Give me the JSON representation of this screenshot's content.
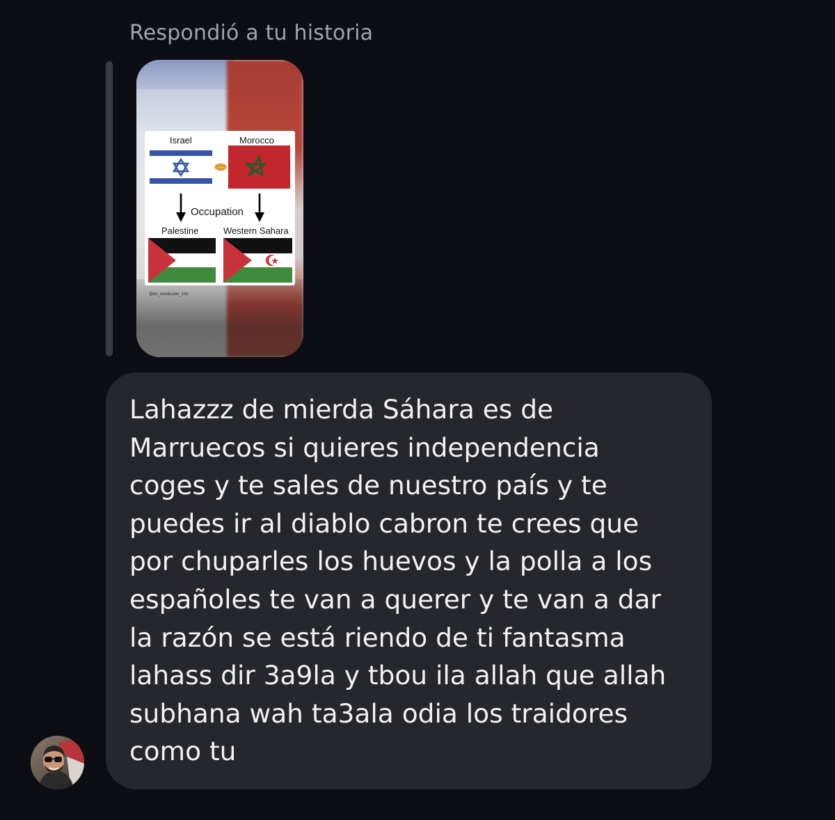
{
  "reply_context": {
    "label": "Respondió a tu historia"
  },
  "story": {
    "poster": {
      "label_israel": "Israel",
      "label_morocco": "Morocco",
      "label_occupation": "Occupation",
      "label_palestine": "Palestine",
      "label_western_sahara": "Western Sahara"
    },
    "handle": "@en_revolucion_13n"
  },
  "message": {
    "lines": [
      "Lahazzz de mierda Sáhara es de",
      "Marruecos si quieres independencia",
      "coges y te sales de nuestro país y te",
      "puedes ir al diablo cabron te crees que",
      "por chuparles los huevos y la polla a los",
      "españoles te van a querer y te van a dar",
      "la razón se está riendo de ti fantasma",
      "lahass dir 3a9la y tbou ila allah que allah",
      "subhana wah ta3ala odia los traidores",
      "como tu"
    ]
  },
  "colors": {
    "background": "#0c0e13",
    "bubble": "#25272c",
    "text": "#f2f2f2",
    "muted": "#a0a4ab"
  },
  "icons": {
    "avatar": "sender-avatar"
  }
}
